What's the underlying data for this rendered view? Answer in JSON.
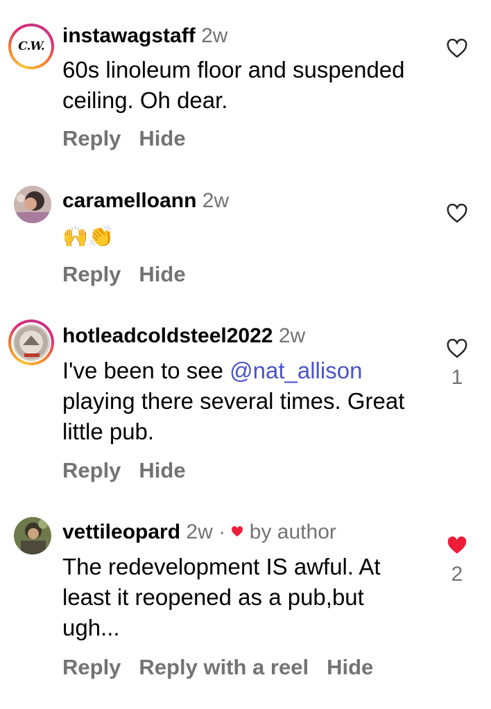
{
  "colors": {
    "username": "#000000",
    "meta": "#737373",
    "mention": "#4a53c7",
    "liked_heart": "#ed1c38"
  },
  "comments": [
    {
      "username": "instawagstaff",
      "time": "2w",
      "avatar": "cw-logo",
      "avatar_text": "C.W.",
      "text": "60s linoleum floor and suspended ceiling. Oh dear.",
      "actions": [
        "Reply",
        "Hide"
      ],
      "liked": false,
      "like_count": ""
    },
    {
      "username": "caramelloann",
      "time": "2w",
      "avatar": "photo",
      "text": "🙌👏",
      "actions": [
        "Reply",
        "Hide"
      ],
      "liked": false,
      "like_count": ""
    },
    {
      "username": "hotleadcoldsteel2022",
      "time": "2w",
      "avatar": "photo-ring",
      "text_before": "I've been to see ",
      "mention": "@nat_allison",
      "text_after": " playing there several times. Great little pub.",
      "actions": [
        "Reply",
        "Hide"
      ],
      "liked": false,
      "like_count": "1"
    },
    {
      "username": "vettileopard",
      "time": "2w",
      "separator": "·",
      "author_badge": "by author",
      "avatar": "photo",
      "text": "The redevelopment IS awful. At least it reopened as a pub,but ugh...",
      "actions": [
        "Reply",
        "Reply with a reel",
        "Hide"
      ],
      "liked": true,
      "like_count": "2"
    }
  ]
}
